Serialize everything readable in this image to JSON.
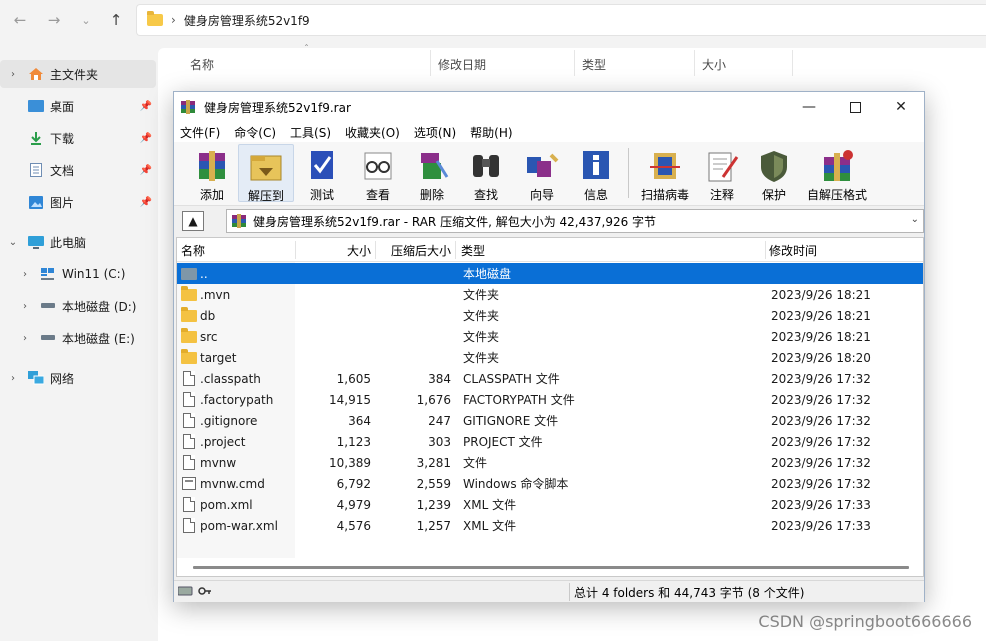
{
  "explorer": {
    "path": "健身房管理系统52v1f9",
    "columns": [
      "名称",
      "修改日期",
      "类型",
      "大小"
    ],
    "sidebar": [
      {
        "label": "主文件夹",
        "icon": "home-icon"
      },
      {
        "label": "桌面",
        "icon": "desktop-icon"
      },
      {
        "label": "下载",
        "icon": "download-icon"
      },
      {
        "label": "文档",
        "icon": "document-icon"
      },
      {
        "label": "图片",
        "icon": "picture-icon"
      },
      {
        "label": "此电脑",
        "icon": "computer-icon"
      },
      {
        "label": "Win11 (C:)",
        "icon": "windows-drive-icon"
      },
      {
        "label": "本地磁盘 (D:)",
        "icon": "drive-icon"
      },
      {
        "label": "本地磁盘 (E:)",
        "icon": "drive-icon"
      },
      {
        "label": "网络",
        "icon": "network-icon"
      }
    ]
  },
  "rar": {
    "title": "健身房管理系统52v1f9.rar",
    "menu": [
      "文件(F)",
      "命令(C)",
      "工具(S)",
      "收藏夹(O)",
      "选项(N)",
      "帮助(H)"
    ],
    "toolbar": [
      "添加",
      "解压到",
      "测试",
      "查看",
      "删除",
      "查找",
      "向导",
      "信息",
      "扫描病毒",
      "注释",
      "保护",
      "自解压格式"
    ],
    "path_text": "健身房管理系统52v1f9.rar - RAR 压缩文件, 解包大小为 42,437,926 字节",
    "columns": {
      "name": "名称",
      "size": "大小",
      "packed": "压缩后大小",
      "type": "类型",
      "modified": "修改时间"
    },
    "rows": [
      {
        "name": "..",
        "size": "",
        "packed": "",
        "type": "本地磁盘",
        "modified": "",
        "kind": "drive"
      },
      {
        "name": ".mvn",
        "size": "",
        "packed": "",
        "type": "文件夹",
        "modified": "2023/9/26 18:21",
        "kind": "folder"
      },
      {
        "name": "db",
        "size": "",
        "packed": "",
        "type": "文件夹",
        "modified": "2023/9/26 18:21",
        "kind": "folder"
      },
      {
        "name": "src",
        "size": "",
        "packed": "",
        "type": "文件夹",
        "modified": "2023/9/26 18:21",
        "kind": "folder"
      },
      {
        "name": "target",
        "size": "",
        "packed": "",
        "type": "文件夹",
        "modified": "2023/9/26 18:20",
        "kind": "folder"
      },
      {
        "name": ".classpath",
        "size": "1,605",
        "packed": "384",
        "type": "CLASSPATH 文件",
        "modified": "2023/9/26 17:32",
        "kind": "file"
      },
      {
        "name": ".factorypath",
        "size": "14,915",
        "packed": "1,676",
        "type": "FACTORYPATH 文件",
        "modified": "2023/9/26 17:32",
        "kind": "file"
      },
      {
        "name": ".gitignore",
        "size": "364",
        "packed": "247",
        "type": "GITIGNORE 文件",
        "modified": "2023/9/26 17:32",
        "kind": "file"
      },
      {
        "name": ".project",
        "size": "1,123",
        "packed": "303",
        "type": "PROJECT 文件",
        "modified": "2023/9/26 17:32",
        "kind": "file"
      },
      {
        "name": "mvnw",
        "size": "10,389",
        "packed": "3,281",
        "type": "文件",
        "modified": "2023/9/26 17:32",
        "kind": "file"
      },
      {
        "name": "mvnw.cmd",
        "size": "6,792",
        "packed": "2,559",
        "type": "Windows 命令脚本",
        "modified": "2023/9/26 17:32",
        "kind": "cmd"
      },
      {
        "name": "pom.xml",
        "size": "4,979",
        "packed": "1,239",
        "type": "XML 文件",
        "modified": "2023/9/26 17:33",
        "kind": "file"
      },
      {
        "name": "pom-war.xml",
        "size": "4,576",
        "packed": "1,257",
        "type": "XML 文件",
        "modified": "2023/9/26 17:33",
        "kind": "file"
      }
    ],
    "status": "总计 4 folders 和 44,743 字节 (8 个文件)",
    "selected_row_color": "#0a6fd6"
  },
  "watermark": "CSDN @springboot666666"
}
